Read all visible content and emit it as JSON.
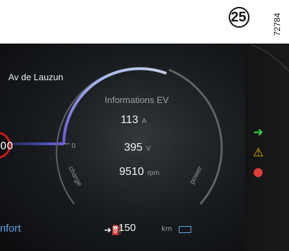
{
  "figure": {
    "callout_number": "25",
    "figure_code": "72784"
  },
  "navigation": {
    "street": "Av de Lauzun"
  },
  "left_gauge": {
    "value_fragment": "00"
  },
  "ev_info": {
    "title": "Informations EV",
    "scale_zero": "0",
    "arc_left_label": "charge",
    "arc_right_label": "power",
    "readouts": [
      {
        "value": "113",
        "unit": "A"
      },
      {
        "value": "395",
        "unit": "V"
      },
      {
        "value": "9510",
        "unit": "rpm"
      }
    ]
  },
  "footer": {
    "drive_mode": "nfort",
    "range_value": "150",
    "range_unit": "km",
    "range_icon": "battery-icon"
  },
  "indicators": [
    {
      "name": "green-arrow-icon",
      "color": "#2fcf3a"
    },
    {
      "name": "seat-belt-icon",
      "color": "#f5b400"
    },
    {
      "name": "airbag-icon",
      "color": "#e23b3b"
    }
  ],
  "colors": {
    "arc_start": "#7a5ff0",
    "arc_end": "#c9c7e6",
    "accent_blue": "#5fa3e8",
    "left_ring": "#d11a1a"
  }
}
